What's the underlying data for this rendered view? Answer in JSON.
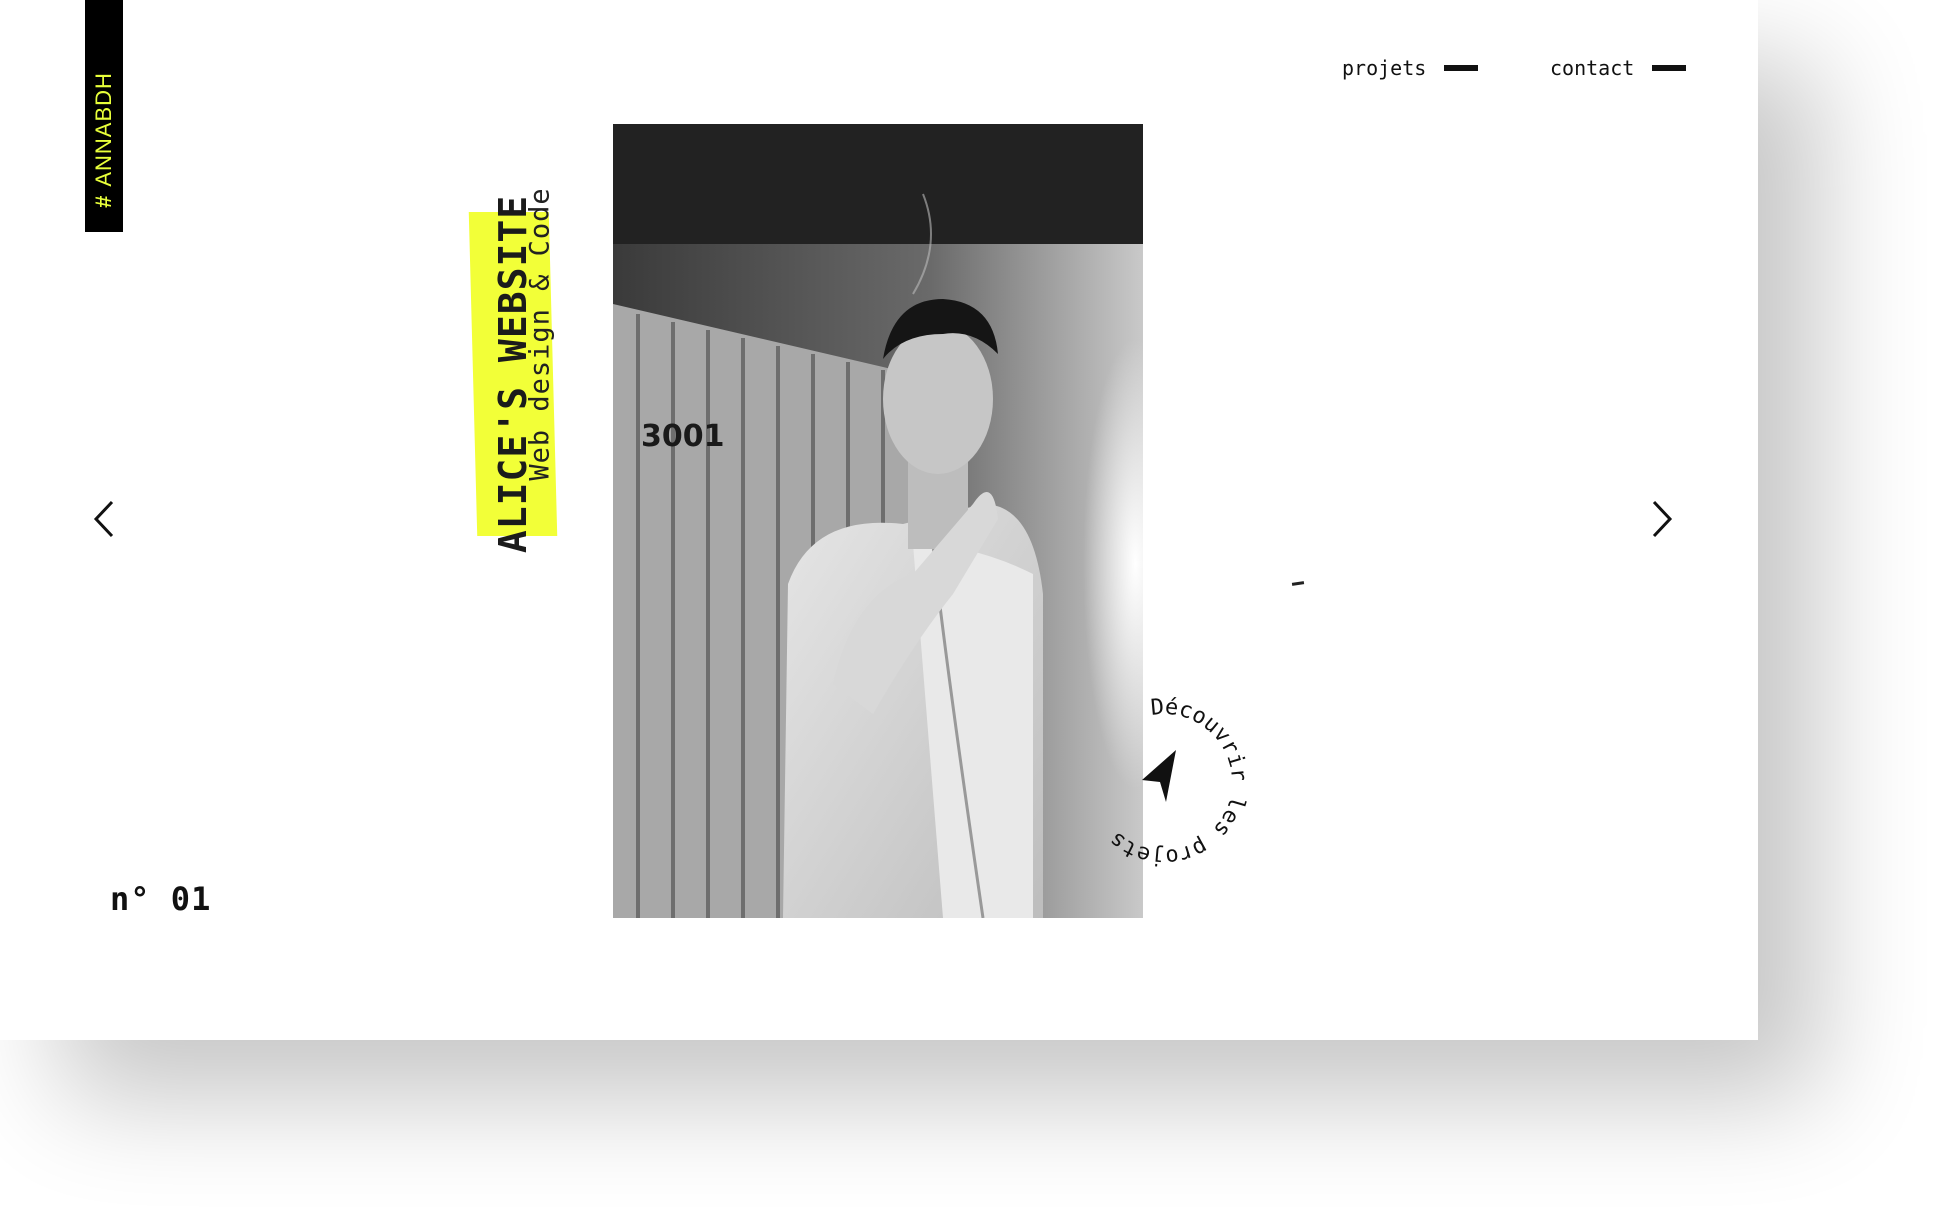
{
  "brand": {
    "tag_symbol": "#",
    "tag_text": "ANNABDH",
    "tag_color": "#e8ff3a"
  },
  "nav": {
    "projets_label": "projets",
    "contact_label": "contact"
  },
  "hero": {
    "title": "ALICE'S WEBSITE",
    "subtitle": "Web design & Code",
    "highlight_color": "#f2ff38",
    "photo_label": "3001",
    "counter": "n° 01"
  },
  "cta": {
    "circle_text": "Découvrir les projets",
    "icon": "navigation-arrow-icon"
  },
  "slider": {
    "prev_icon": "chevron-left-icon",
    "next_icon": "chevron-right-icon"
  }
}
